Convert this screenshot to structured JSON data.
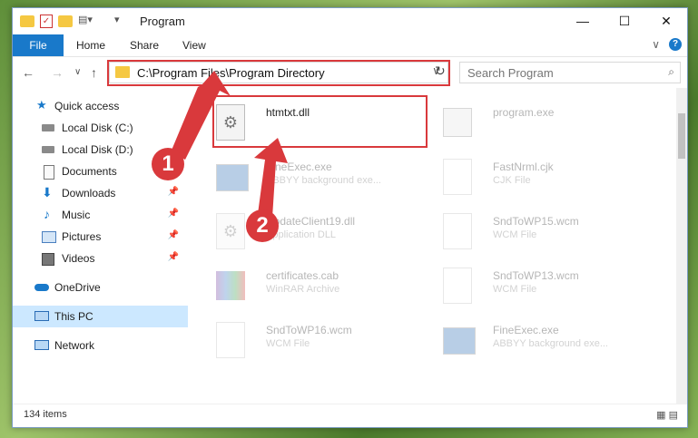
{
  "window": {
    "title": "Program"
  },
  "window_controls": {
    "minimize": "—",
    "maximize": "☐",
    "close": "✕"
  },
  "ribbon": {
    "tabs": [
      "File",
      "Home",
      "Share",
      "View"
    ],
    "expand": "∨",
    "help": "?"
  },
  "nav": {
    "back": "←",
    "forward": "→",
    "recent": "∨",
    "up": "↑"
  },
  "address": {
    "path": "C:\\Program Files\\Program Directory",
    "dropdown": "∨",
    "refresh": "↻"
  },
  "search": {
    "placeholder": "Search Program",
    "icon": "⌕"
  },
  "sidebar": {
    "items": [
      {
        "label": "Quick access",
        "icon": "star-icon",
        "pinned": false
      },
      {
        "label": "Local Disk (C:)",
        "icon": "drive-icon",
        "pinned": false
      },
      {
        "label": "Local Disk (D:)",
        "icon": "drive-icon",
        "pinned": false
      },
      {
        "label": "Documents",
        "icon": "document-icon",
        "pinned": false
      },
      {
        "label": "Downloads",
        "icon": "download-icon",
        "pinned": true
      },
      {
        "label": "Music",
        "icon": "music-icon",
        "pinned": true
      },
      {
        "label": "Pictures",
        "icon": "picture-icon",
        "pinned": true
      },
      {
        "label": "Videos",
        "icon": "video-icon",
        "pinned": true
      },
      {
        "label": "OneDrive",
        "icon": "cloud-icon",
        "pinned": false
      },
      {
        "label": "This PC",
        "icon": "computer-icon",
        "pinned": false,
        "selected": true
      },
      {
        "label": "Network",
        "icon": "network-icon",
        "pinned": false
      }
    ],
    "pin_glyph": "📌"
  },
  "files": {
    "left": [
      {
        "name": "htmtxt.dll",
        "type": "",
        "icon": "dll-gear-icon"
      },
      {
        "name": "FineExec.exe",
        "type": "ABBYY background exe...",
        "icon": "exe-icon"
      },
      {
        "name": "UpdateClient19.dll",
        "type": "Application DLL",
        "icon": "dll-gear-icon"
      },
      {
        "name": "certificates.cab",
        "type": "WinRAR Archive",
        "icon": "archive-icon"
      },
      {
        "name": "SndToWP16.wcm",
        "type": "WCM File",
        "icon": "blank-file-icon"
      }
    ],
    "right": [
      {
        "name": "program.exe",
        "type": "",
        "icon": "app-icon"
      },
      {
        "name": "FastNrml.cjk",
        "type": "CJK File",
        "icon": "blank-file-icon"
      },
      {
        "name": "SndToWP15.wcm",
        "type": "WCM File",
        "icon": "blank-file-icon"
      },
      {
        "name": "SndToWP13.wcm",
        "type": "WCM File",
        "icon": "blank-file-icon"
      },
      {
        "name": "FineExec.exe",
        "type": "ABBYY background exe...",
        "icon": "exe-icon"
      }
    ]
  },
  "status": {
    "count": "134 items"
  },
  "annotations": {
    "step1": "1",
    "step2": "2",
    "highlight_color": "#d9393c"
  },
  "colors": {
    "accent": "#1979ca",
    "selected": "#cce8ff",
    "folder": "#f5c842"
  }
}
